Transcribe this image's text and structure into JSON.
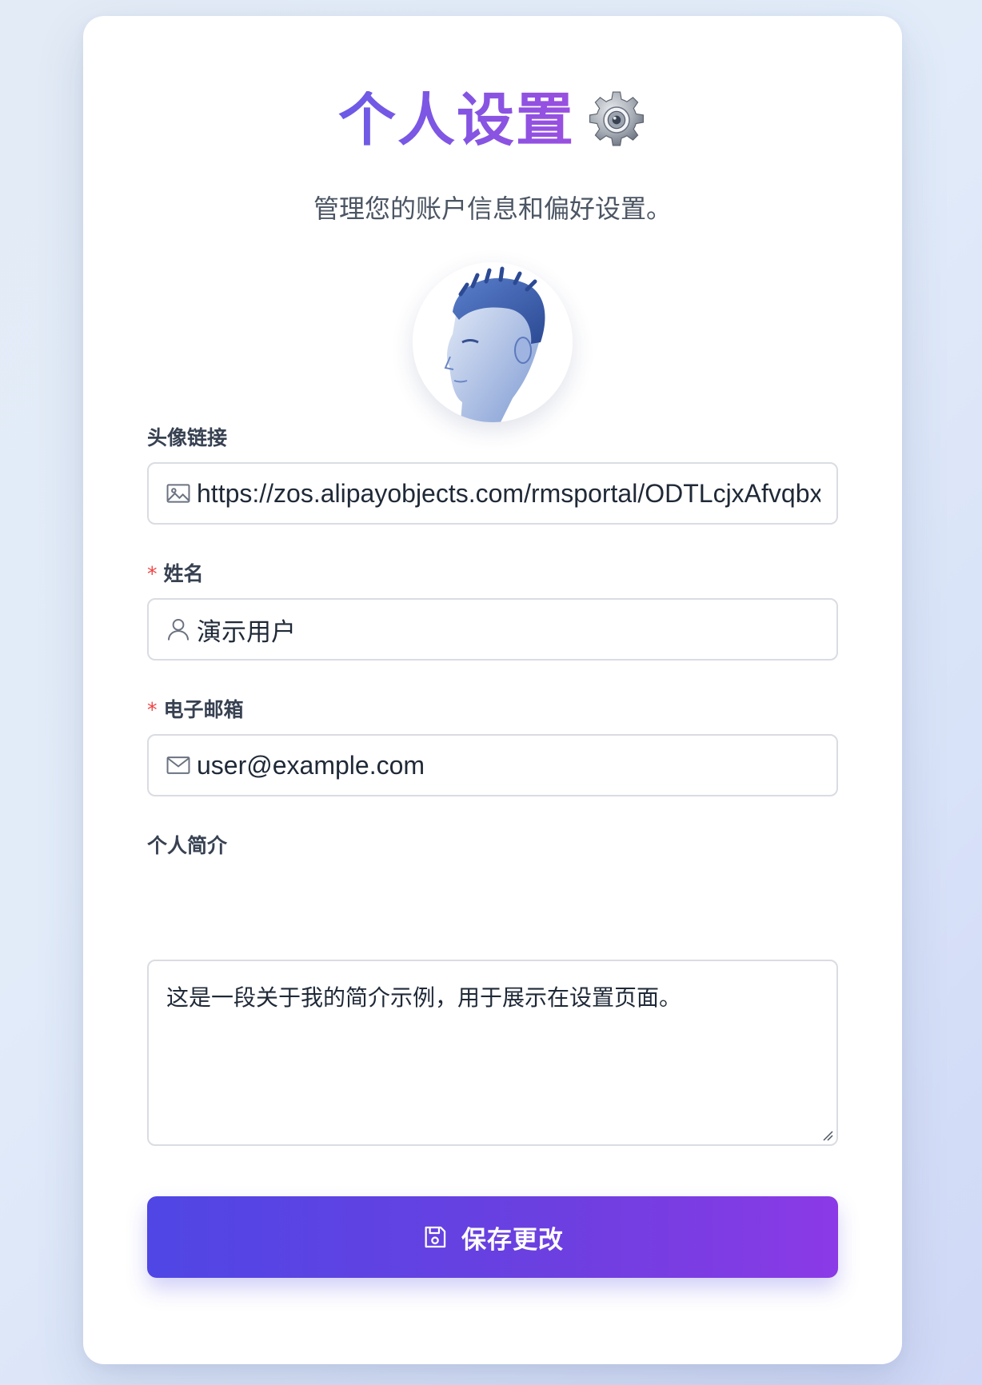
{
  "header": {
    "title": "个人设置",
    "title_icon": "gear-icon",
    "subtitle": "管理您的账户信息和偏好设置。"
  },
  "avatar": {
    "icon": "avatar-portrait"
  },
  "fields": {
    "avatar_url": {
      "label": "头像链接",
      "icon": "image-icon",
      "value": "https://zos.alipayobjects.com/rmsportal/ODTLcjxAfvqbxHnVXCYX.png"
    },
    "name": {
      "label": "姓名",
      "required_mark": "*",
      "icon": "user-icon",
      "value": "演示用户"
    },
    "email": {
      "label": "电子邮箱",
      "required_mark": "*",
      "icon": "mail-icon",
      "value": "user@example.com"
    },
    "bio": {
      "label": "个人简介",
      "value": "这是一段关于我的简介示例，用于展示在设置页面。"
    }
  },
  "actions": {
    "save_label": "保存更改",
    "save_icon": "save-icon"
  },
  "colors": {
    "accent_start": "#4f46e5",
    "accent_end": "#8b3ae6",
    "title_start": "#6b5be6",
    "title_end": "#9a4fe0",
    "required": "#ef4444"
  }
}
